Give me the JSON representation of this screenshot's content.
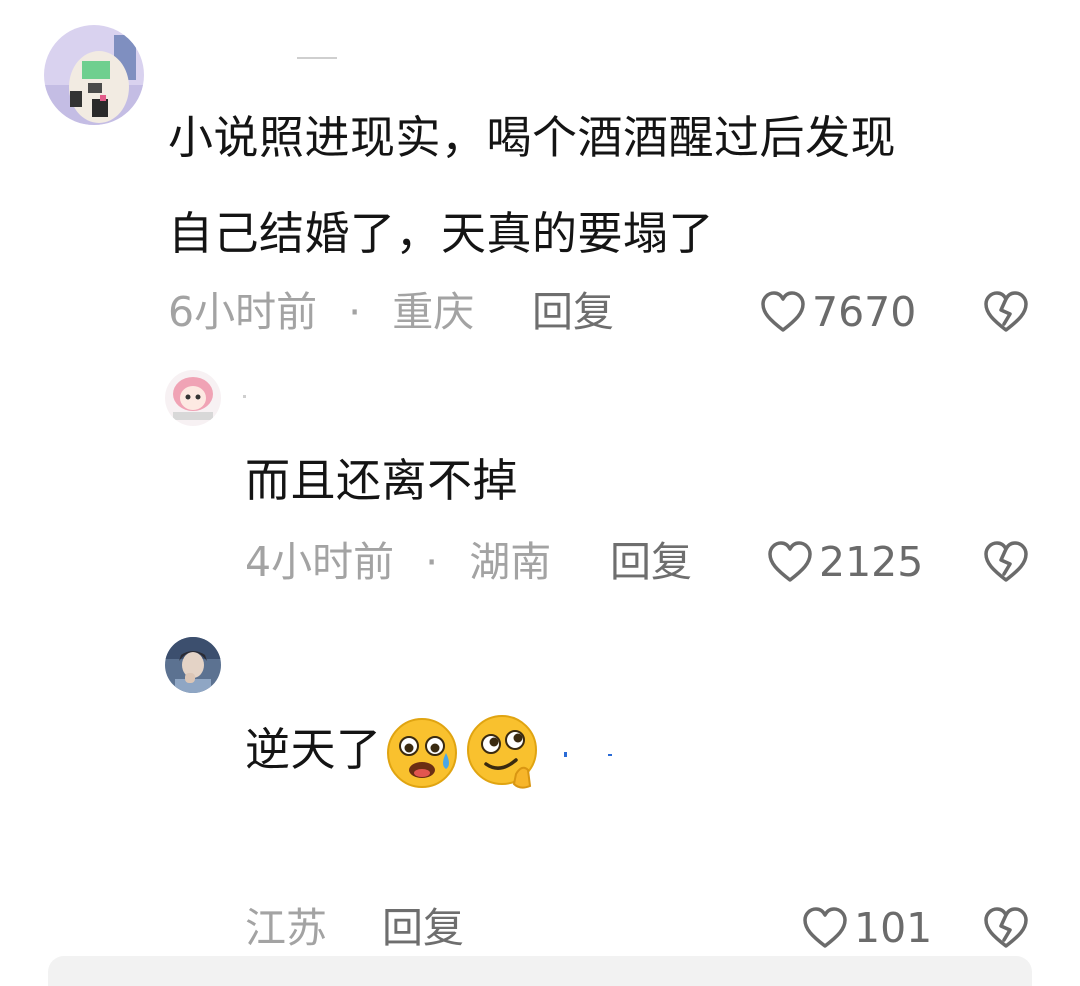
{
  "comments": [
    {
      "text_line1": "小说照进现实，喝个酒酒醒过后发现",
      "text_line2": "自己结婚了，天真的要塌了",
      "time": "6小时前",
      "separator": "·",
      "location": "重庆",
      "reply_label": "回复",
      "likes": "7670"
    },
    {
      "text": "而且还离不掉",
      "time": "4小时前",
      "separator": "·",
      "location": "湖南",
      "reply_label": "回复",
      "likes": "2125"
    },
    {
      "text": "逆天了",
      "emojis": [
        "worried-crying-face-emoji",
        "thinking-smirk-face-emoji"
      ],
      "location": "江苏",
      "reply_label": "回复",
      "likes": "101"
    }
  ],
  "colors": {
    "text": "#141414",
    "meta": "#a3a3a3",
    "action": "#6e6e6e"
  }
}
